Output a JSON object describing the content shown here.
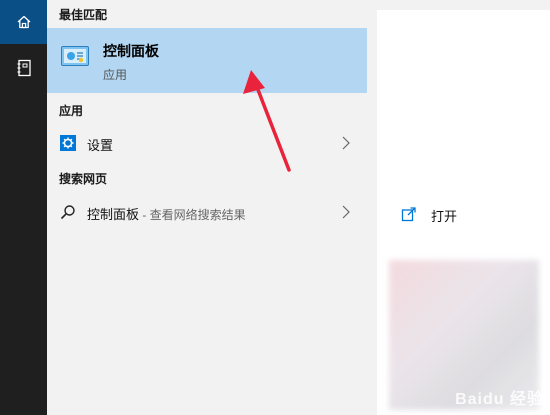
{
  "sections": {
    "best_match_header": "最佳匹配",
    "apps_header": "应用",
    "web_header": "搜索网页"
  },
  "best_match": {
    "title": "控制面板",
    "subtitle": "应用"
  },
  "apps": [
    {
      "label": "设置"
    }
  ],
  "web": [
    {
      "label": "控制面板",
      "suffix": " - 查看网络搜索结果"
    }
  ],
  "preview": {
    "open_label": "打开"
  },
  "watermark": "Baidu 经验",
  "colors": {
    "rail": "#1f1f1f",
    "rail_active": "#0a4f86",
    "selected": "#b3d7f2",
    "accent": "#0078d7",
    "arrow": "#e8233b"
  }
}
